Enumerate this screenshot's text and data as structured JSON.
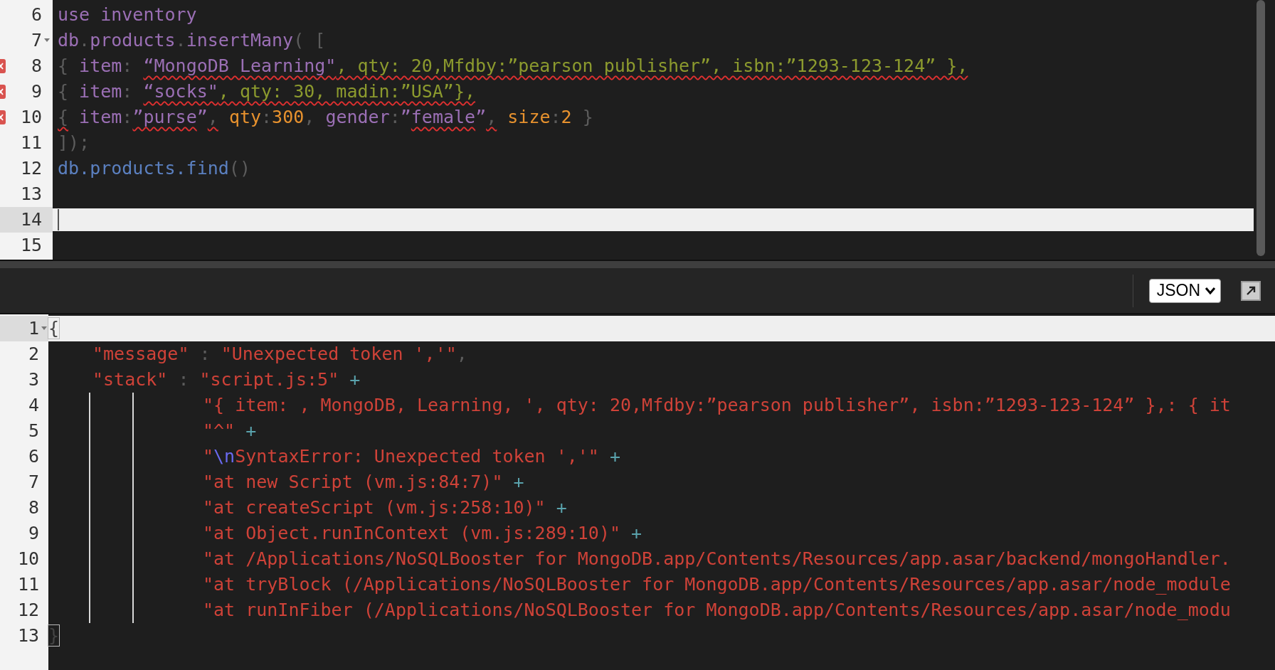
{
  "editor": {
    "lines": [
      {
        "number": "6",
        "fold": false,
        "error": false,
        "current": false,
        "tokens": [
          {
            "text": "use inventory",
            "kind": "ident",
            "squiggle": false
          }
        ]
      },
      {
        "number": "7",
        "fold": true,
        "error": false,
        "current": false,
        "tokens": [
          {
            "text": "db",
            "kind": "ident",
            "squiggle": false
          },
          {
            "text": ".",
            "kind": "punct",
            "squiggle": false
          },
          {
            "text": "products",
            "kind": "ident",
            "squiggle": false
          },
          {
            "text": ".",
            "kind": "punct",
            "squiggle": false
          },
          {
            "text": "insertMany",
            "kind": "ident",
            "squiggle": false
          },
          {
            "text": "( [",
            "kind": "punct",
            "squiggle": false
          }
        ]
      },
      {
        "number": "8",
        "fold": false,
        "error": true,
        "current": false,
        "tokens": [
          {
            "text": "{",
            "kind": "punct",
            "squiggle": false
          },
          {
            "text": " item",
            "kind": "ident",
            "squiggle": false
          },
          {
            "text": ": ",
            "kind": "punct",
            "squiggle": false
          },
          {
            "text": "“MongoDB",
            "kind": "ident",
            "squiggle": true
          },
          {
            "text": " Learning\"",
            "kind": "ident",
            "squiggle": true
          },
          {
            "text": ", qty: 20,Mfdby:”pearson publisher”, isbn:”1293-123-124” },",
            "kind": "string",
            "squiggle": true
          }
        ]
      },
      {
        "number": "9",
        "fold": false,
        "error": true,
        "current": false,
        "tokens": [
          {
            "text": "{",
            "kind": "punct",
            "squiggle": false
          },
          {
            "text": " item",
            "kind": "ident",
            "squiggle": false
          },
          {
            "text": ": ",
            "kind": "punct",
            "squiggle": false
          },
          {
            "text": "“socks\"",
            "kind": "ident",
            "squiggle": true
          },
          {
            "text": ", qty: 30, madin:”USA”},",
            "kind": "string",
            "squiggle": true
          }
        ]
      },
      {
        "number": "10",
        "fold": false,
        "error": true,
        "current": false,
        "tokens": [
          {
            "text": "{",
            "kind": "punct",
            "squiggle": true
          },
          {
            "text": " item",
            "kind": "ident",
            "squiggle": false
          },
          {
            "text": ":",
            "kind": "punct",
            "squiggle": false
          },
          {
            "text": "”purse",
            "kind": "ident",
            "squiggle": true
          },
          {
            "text": "”",
            "kind": "ident",
            "squiggle": false
          },
          {
            "text": ",",
            "kind": "punct",
            "squiggle": true
          },
          {
            "text": " qty",
            "kind": "field",
            "squiggle": false
          },
          {
            "text": ":",
            "kind": "punct",
            "squiggle": false
          },
          {
            "text": "300",
            "kind": "field",
            "squiggle": false
          },
          {
            "text": ", ",
            "kind": "punct",
            "squiggle": false
          },
          {
            "text": "gender",
            "kind": "ident",
            "squiggle": false
          },
          {
            "text": ":",
            "kind": "punct",
            "squiggle": false
          },
          {
            "text": "”",
            "kind": "ident",
            "squiggle": false
          },
          {
            "text": "female",
            "kind": "ident",
            "squiggle": true
          },
          {
            "text": "”",
            "kind": "ident",
            "squiggle": false
          },
          {
            "text": ",",
            "kind": "punct",
            "squiggle": true
          },
          {
            "text": " size",
            "kind": "field",
            "squiggle": false
          },
          {
            "text": ":",
            "kind": "punct",
            "squiggle": false
          },
          {
            "text": "2",
            "kind": "field",
            "squiggle": false
          },
          {
            "text": " }",
            "kind": "punct",
            "squiggle": false
          }
        ]
      },
      {
        "number": "11",
        "fold": false,
        "error": false,
        "current": false,
        "tokens": [
          {
            "text": "]);",
            "kind": "punct",
            "squiggle": false
          }
        ]
      },
      {
        "number": "12",
        "fold": false,
        "error": false,
        "current": false,
        "tokens": [
          {
            "text": "db.products.find",
            "kind": "method",
            "squiggle": false
          },
          {
            "text": "()",
            "kind": "punct",
            "squiggle": false
          }
        ]
      },
      {
        "number": "13",
        "fold": false,
        "error": false,
        "current": false
      },
      {
        "number": "14",
        "fold": false,
        "error": false,
        "current": true
      },
      {
        "number": "15",
        "fold": false,
        "error": false,
        "current": false
      }
    ]
  },
  "toolbar": {
    "format_select": {
      "value": "JSON"
    }
  },
  "output": {
    "lines": [
      {
        "number": "1",
        "kind": "plain",
        "fold": true,
        "current": true,
        "tokens": [
          {
            "text": "{",
            "kind": "punct",
            "matched": true
          }
        ]
      },
      {
        "number": "2",
        "kind": "member",
        "fold": false,
        "current": false,
        "tokens": [
          {
            "text": "\"message\"",
            "kind": "string"
          },
          {
            "text": " : ",
            "kind": "punct"
          },
          {
            "text": "\"Unexpected token ','\"",
            "kind": "string"
          },
          {
            "text": ",",
            "kind": "punct"
          }
        ]
      },
      {
        "number": "3",
        "kind": "member",
        "fold": false,
        "current": false,
        "tokens": [
          {
            "text": "\"stack\"",
            "kind": "string"
          },
          {
            "text": " : ",
            "kind": "punct"
          },
          {
            "text": "\"script.js:5\"",
            "kind": "string"
          },
          {
            "text": " +",
            "kind": "operator"
          }
        ]
      },
      {
        "number": "4",
        "kind": "continuation",
        "fold": false,
        "current": false,
        "tokens": [
          {
            "text": "\"{ item: , MongoDB, Learning, ', qty: 20,Mfdby:”pearson publisher”, isbn:”1293-123-124” },: { it",
            "kind": "string"
          }
        ]
      },
      {
        "number": "5",
        "kind": "continuation",
        "fold": false,
        "current": false,
        "tokens": [
          {
            "text": "\"^\"",
            "kind": "string"
          },
          {
            "text": " +",
            "kind": "operator"
          }
        ]
      },
      {
        "number": "6",
        "kind": "continuation",
        "fold": false,
        "current": false,
        "tokens": [
          {
            "text": "\"",
            "kind": "string"
          },
          {
            "text": "\\n",
            "kind": "escape"
          },
          {
            "text": "SyntaxError: Unexpected token ','\"",
            "kind": "string"
          },
          {
            "text": " +",
            "kind": "operator"
          }
        ]
      },
      {
        "number": "7",
        "kind": "continuation",
        "fold": false,
        "current": false,
        "tokens": [
          {
            "text": "\"at new Script (vm.js:84:7)\"",
            "kind": "string"
          },
          {
            "text": " +",
            "kind": "operator"
          }
        ]
      },
      {
        "number": "8",
        "kind": "continuation",
        "fold": false,
        "current": false,
        "tokens": [
          {
            "text": "\"at createScript (vm.js:258:10)\"",
            "kind": "string"
          },
          {
            "text": " +",
            "kind": "operator"
          }
        ]
      },
      {
        "number": "9",
        "kind": "continuation",
        "fold": false,
        "current": false,
        "tokens": [
          {
            "text": "\"at Object.runInContext (vm.js:289:10)\"",
            "kind": "string"
          },
          {
            "text": " +",
            "kind": "operator"
          }
        ]
      },
      {
        "number": "10",
        "kind": "continuation",
        "fold": false,
        "current": false,
        "tokens": [
          {
            "text": "\"at /Applications/NoSQLBooster for MongoDB.app/Contents/Resources/app.asar/backend/mongoHandler.",
            "kind": "string"
          }
        ]
      },
      {
        "number": "11",
        "kind": "continuation",
        "fold": false,
        "current": false,
        "tokens": [
          {
            "text": "\"at tryBlock (/Applications/NoSQLBooster for MongoDB.app/Contents/Resources/app.asar/node_module",
            "kind": "string"
          }
        ]
      },
      {
        "number": "12",
        "kind": "continuation",
        "fold": false,
        "current": false,
        "tokens": [
          {
            "text": "\"at runInFiber (/Applications/NoSQLBooster for MongoDB.app/Contents/Resources/app.asar/node_modu",
            "kind": "string"
          }
        ]
      },
      {
        "number": "13",
        "kind": "plain",
        "fold": false,
        "current": false,
        "tokens": [
          {
            "text": "}",
            "kind": "punct",
            "matched": true
          }
        ]
      }
    ]
  }
}
